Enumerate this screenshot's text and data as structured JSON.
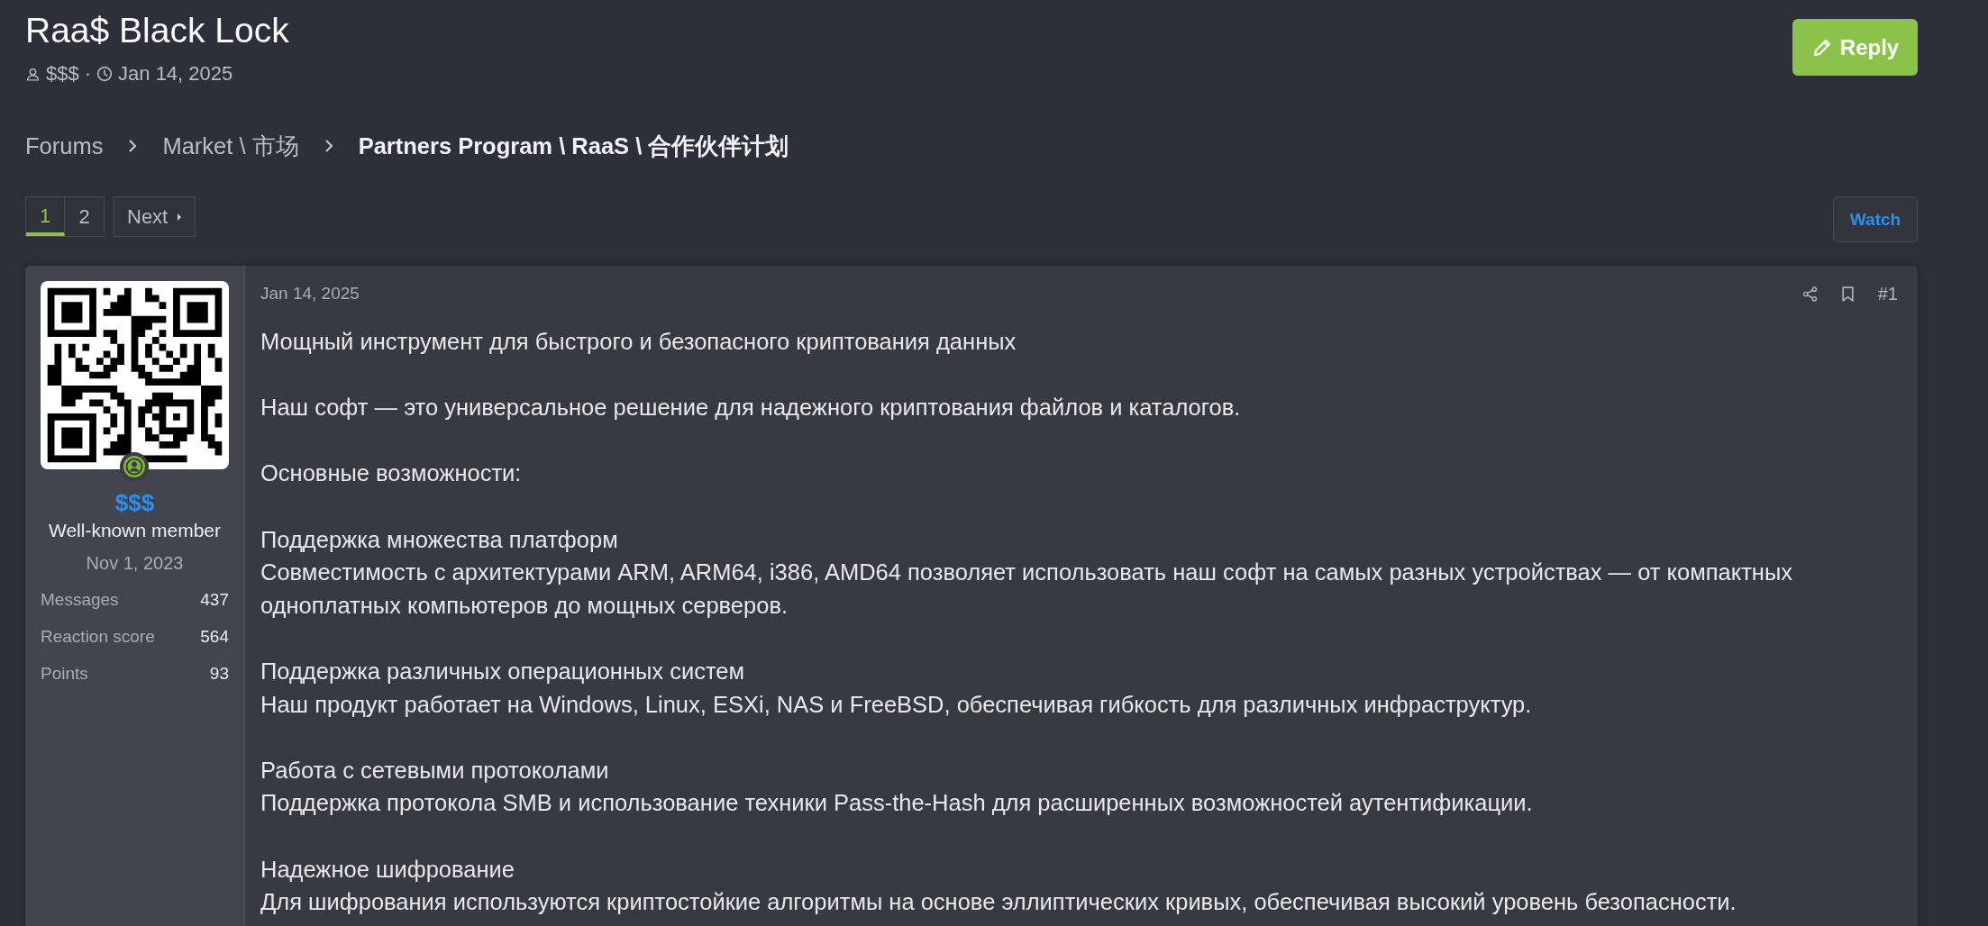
{
  "thread": {
    "title": "Raa$ Black Lock",
    "author": "$$$",
    "separator": "·",
    "date": "Jan 14, 2025"
  },
  "reply_button": "Reply",
  "breadcrumbs": [
    {
      "label": "Forums",
      "current": false
    },
    {
      "label": "Market \\ 市场",
      "current": false
    },
    {
      "label": "Partners Program \\ RaaS \\ 合作伙伴计划",
      "current": true
    }
  ],
  "pagination": {
    "pages": [
      {
        "label": "1",
        "selected": true
      },
      {
        "label": "2",
        "selected": false
      }
    ],
    "next": "Next"
  },
  "watch_button": "Watch",
  "post": {
    "user": {
      "name": "$$$",
      "online": true,
      "title": "Well-known member",
      "joined": "Nov 1, 2023",
      "stats": [
        {
          "label": "Messages",
          "value": "437"
        },
        {
          "label": "Reaction score",
          "value": "564"
        },
        {
          "label": "Points",
          "value": "93"
        }
      ]
    },
    "date": "Jan 14, 2025",
    "number": "#1",
    "paragraphs": [
      [
        "Мощный инструмент для быстрого и безопасного криптования данных"
      ],
      [
        "Наш софт — это универсальное решение для надежного криптования файлов и каталогов."
      ],
      [
        "Основные возможности:"
      ],
      [
        "Поддержка множества платформ",
        "Совместимость с архитектурами ARM, ARM64, i386, AMD64 позволяет использовать наш софт на самых разных устройствах — от компактных одноплатных компьютеров до мощных серверов."
      ],
      [
        "Поддержка различных операционных систем",
        "Наш продукт работает на Windows, Linux, ESXi, NAS и FreeBSD, обеспечивая гибкость для различных инфраструктур."
      ],
      [
        "Работа с сетевыми протоколами",
        "Поддержка протокола SMB и использование техники Pass-the-Hash для расширенных возможностей аутентификации."
      ],
      [
        "Надежное шифрование",
        "Для шифрования используются криптостойкие алгоритмы на основе эллиптических кривых, обеспечивая высокий уровень безопасности."
      ]
    ]
  }
}
